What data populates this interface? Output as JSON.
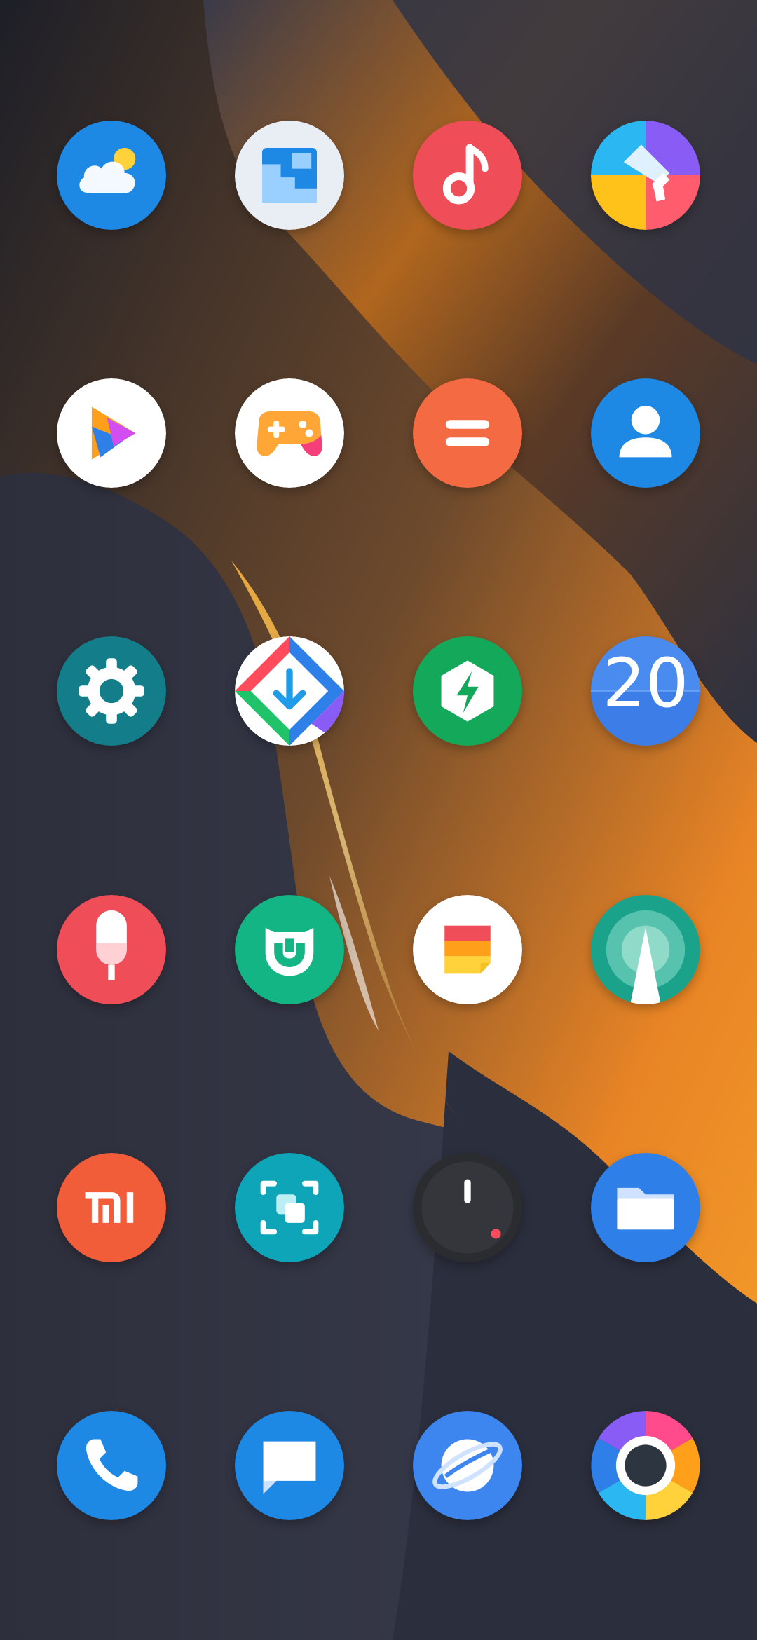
{
  "home_screen": {
    "rows": [
      [
        "weather-icon",
        "gallery-icon",
        "music-icon",
        "themes-icon"
      ],
      [
        "video-player-icon",
        "game-center-icon",
        "calculator-icon",
        "contacts-icon"
      ],
      [
        "settings-icon",
        "app-downloader-icon",
        "security-icon",
        "calendar-icon"
      ],
      [
        "voice-recorder-icon",
        "mi-home-icon",
        "notes-icon",
        "compass-icon"
      ],
      [
        "mi-community-icon",
        "screen-scanner-icon",
        "clock-icon",
        "file-manager-icon"
      ],
      [
        "phone-icon",
        "messages-icon",
        "browser-icon",
        "camera-icon"
      ]
    ],
    "calendar_date": "20"
  },
  "colors": {
    "weather": "#1e88e5",
    "gallery_bg": "#e9eef5",
    "music": "#ef4d57",
    "calculator": "#f46a43",
    "contacts": "#1e88e5",
    "settings": "#137e8a",
    "security": "#14a85a",
    "calendar": "#3d7de8",
    "recorder": "#ef4d57",
    "mi_home": "#13b585",
    "compass": "#1aa28a",
    "mi_community": "#f25d39",
    "scanner": "#0fa5b8",
    "clock": "#2b2c30",
    "files": "#2f7fe8",
    "phone": "#1e88e5",
    "messages": "#1e88e5",
    "browser": "#3d86ef"
  }
}
